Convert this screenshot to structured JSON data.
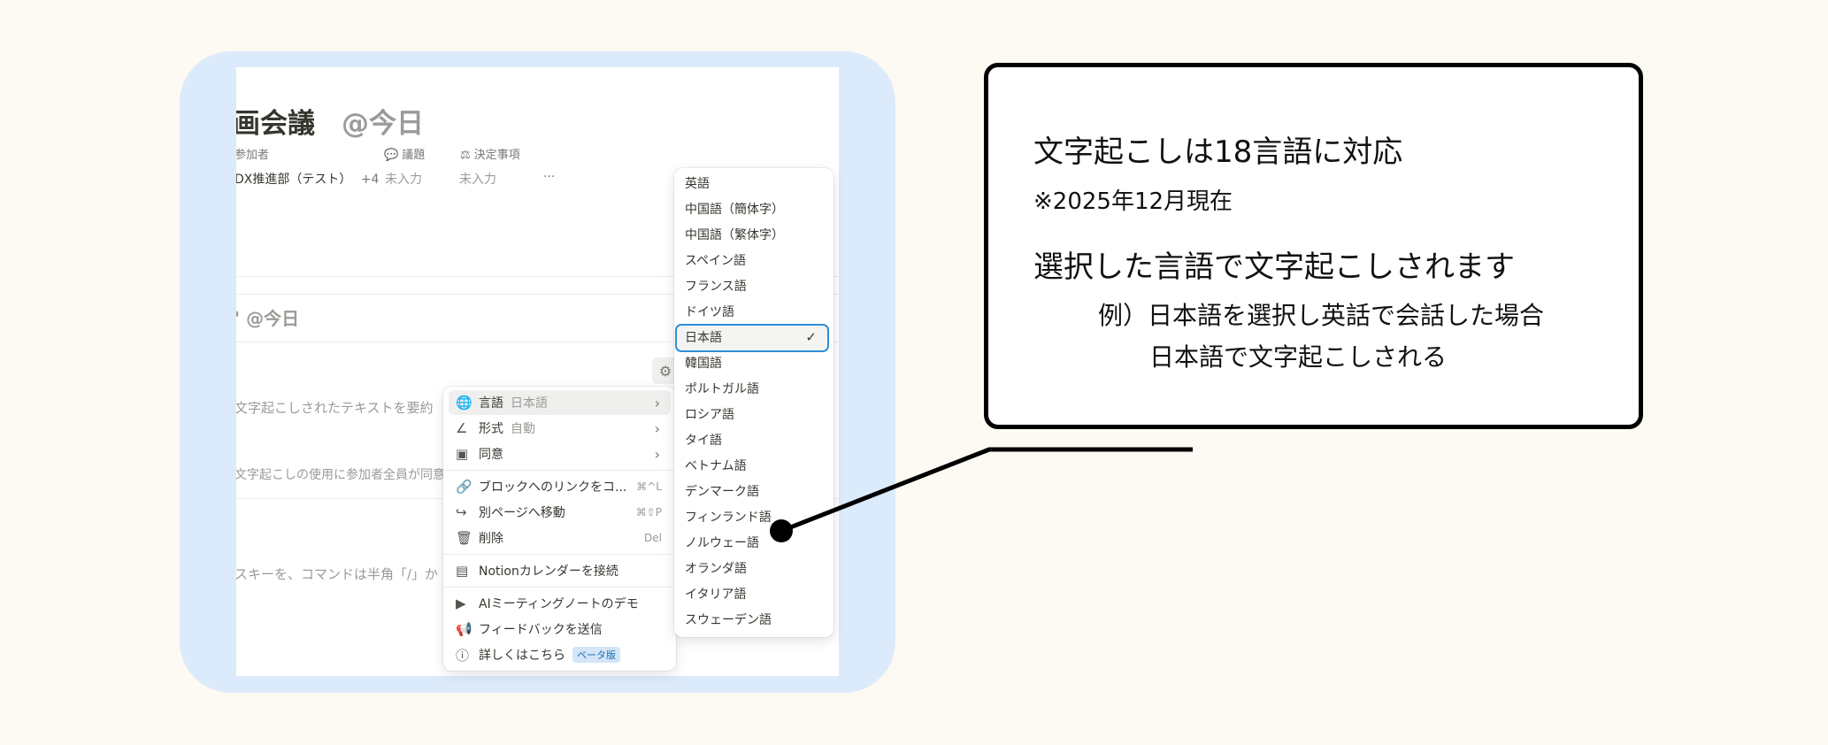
{
  "page": {
    "title": "画会議",
    "title_mention": "@今日",
    "properties": [
      {
        "label": "参加者",
        "value": "DX推進部（テスト）",
        "extra": "+4"
      },
      {
        "label": "議題",
        "value": "未入力"
      },
      {
        "label": "決定事項",
        "value": "未入力"
      }
    ],
    "more": "···",
    "sub_heading": "' @今日",
    "summary_text": "文字起こしされたテキストを要約",
    "consent_text": "文字起こしの使用に参加者全員が同意",
    "command_text": "スキーを、コマンドは半角「/」か"
  },
  "context_menu": {
    "items": [
      {
        "label": "言語",
        "sub": "日本語",
        "icon": "globe-icon",
        "chevron": "›"
      },
      {
        "label": "形式",
        "sub": "自動",
        "icon": "pen-icon",
        "chevron": "›"
      },
      {
        "label": "同意",
        "icon": "consent-icon",
        "chevron": "›"
      },
      {
        "label": "ブロックへのリンクをコ...",
        "shortcut": "⌘^L",
        "icon": "link-icon"
      },
      {
        "label": "別ページへ移動",
        "shortcut": "⌘⇧P",
        "icon": "move-icon"
      },
      {
        "label": "削除",
        "shortcut": "Del",
        "icon": "trash-icon"
      },
      {
        "label": "Notionカレンダーを接続",
        "icon": "calendar-icon"
      },
      {
        "label": "AIミーティングノートのデモ",
        "icon": "play-icon"
      },
      {
        "label": "フィードバックを送信",
        "icon": "megaphone-icon"
      },
      {
        "label": "詳しくはこちら",
        "badge": "ベータ版",
        "icon": "help-icon"
      }
    ]
  },
  "language_menu": {
    "languages": [
      "英語",
      "中国語（簡体字）",
      "中国語（繁体字）",
      "スペイン語",
      "フランス語",
      "ドイツ語",
      "日本語",
      "韓国語",
      "ポルトガル語",
      "ロシア語",
      "タイ語",
      "ベトナム語",
      "デンマーク語",
      "フィンランド語",
      "ノルウェー語",
      "オランダ語",
      "イタリア語",
      "スウェーデン語"
    ],
    "selected": "日本語",
    "check": "✓"
  },
  "callout": {
    "line1": "文字起こしは18言語に対応",
    "line2": "※2025年12月現在",
    "line3": "選択した言語で文字起こしされます",
    "line4": "例）日本語を選択し英話で会話した場合",
    "line5": "日本語で文字起こしされる"
  },
  "colors": {
    "background": "#fdfaf3",
    "frame": "#dcebfb",
    "selection_border": "#2f8fd8"
  }
}
